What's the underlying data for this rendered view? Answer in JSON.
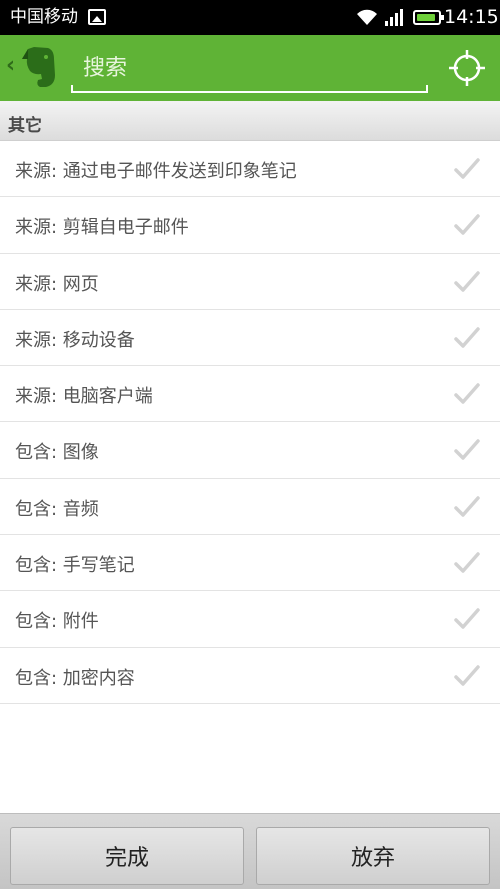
{
  "status_bar": {
    "carrier": "中国移动",
    "time": "14:15",
    "battery_level": 0.9,
    "icons": [
      "image-icon",
      "wifi-icon",
      "signal-icon",
      "battery-icon"
    ]
  },
  "header": {
    "back_icon": "chevron-left-icon",
    "logo_icon": "evernote-elephant-icon",
    "search_placeholder": "搜索",
    "locate_icon": "crosshair-icon"
  },
  "section": {
    "title": "其它"
  },
  "items": [
    {
      "label": "来源: 通过电子邮件发送到印象笔记",
      "checked": false
    },
    {
      "label": "来源: 剪辑自电子邮件",
      "checked": false
    },
    {
      "label": "来源: 网页",
      "checked": false
    },
    {
      "label": "来源: 移动设备",
      "checked": false
    },
    {
      "label": "来源: 电脑客户端",
      "checked": false
    },
    {
      "label": "包含: 图像",
      "checked": false
    },
    {
      "label": "包含: 音频",
      "checked": false
    },
    {
      "label": "包含: 手写笔记",
      "checked": false
    },
    {
      "label": "包含: 附件",
      "checked": false
    },
    {
      "label": "包含: 加密内容",
      "checked": false
    }
  ],
  "footer": {
    "done_label": "完成",
    "discard_label": "放弃"
  },
  "colors": {
    "header_green": "#5fb336",
    "check_gray": "#d2d2d2"
  }
}
